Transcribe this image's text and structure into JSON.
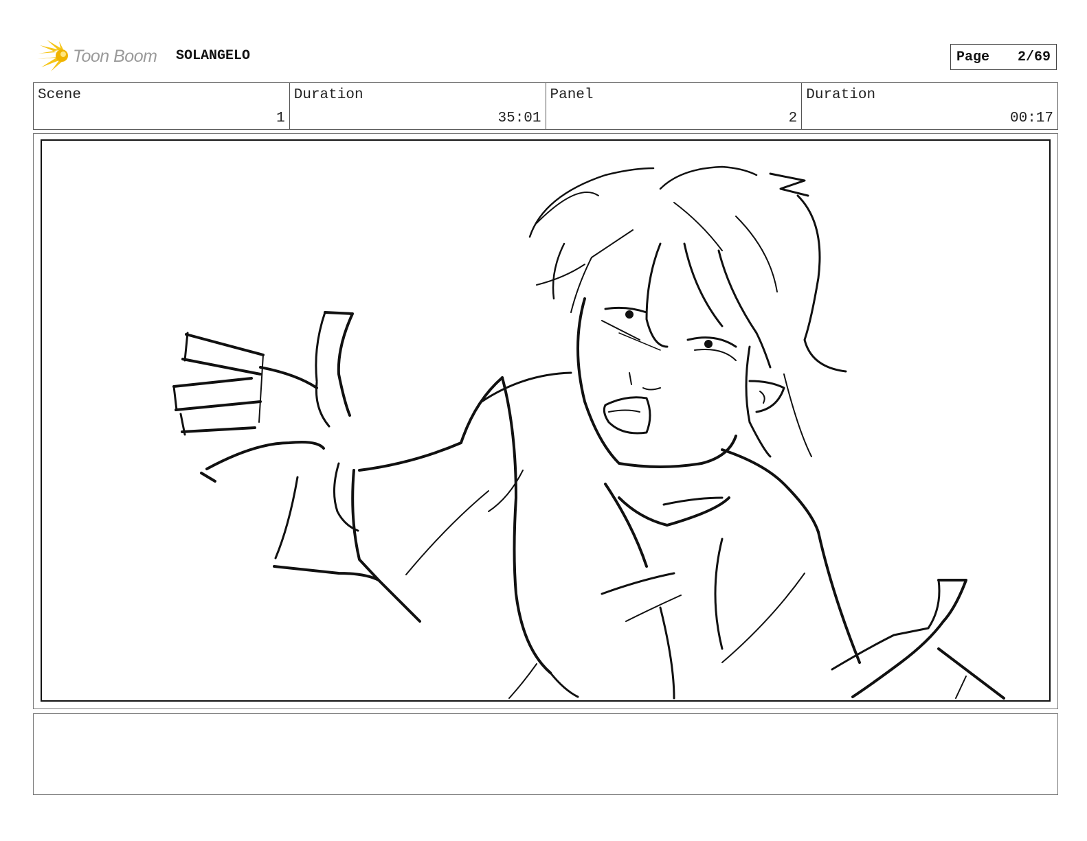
{
  "header": {
    "logo_text": "Toon Boom",
    "project_title": "SOLANGELO",
    "page_label": "Page",
    "page_value": "2/69"
  },
  "info": {
    "scene_label": "Scene",
    "scene_value": "1",
    "scene_duration_label": "Duration",
    "scene_duration_value": "35:01",
    "panel_label": "Panel",
    "panel_value": "2",
    "panel_duration_label": "Duration",
    "panel_duration_value": "00:17"
  },
  "panel": {
    "image": "storyboard-sketch"
  },
  "notes": {
    "text": ""
  },
  "colors": {
    "logo_accent": "#f5c518",
    "logo_text": "#9a9a9a",
    "border": "#555555"
  }
}
